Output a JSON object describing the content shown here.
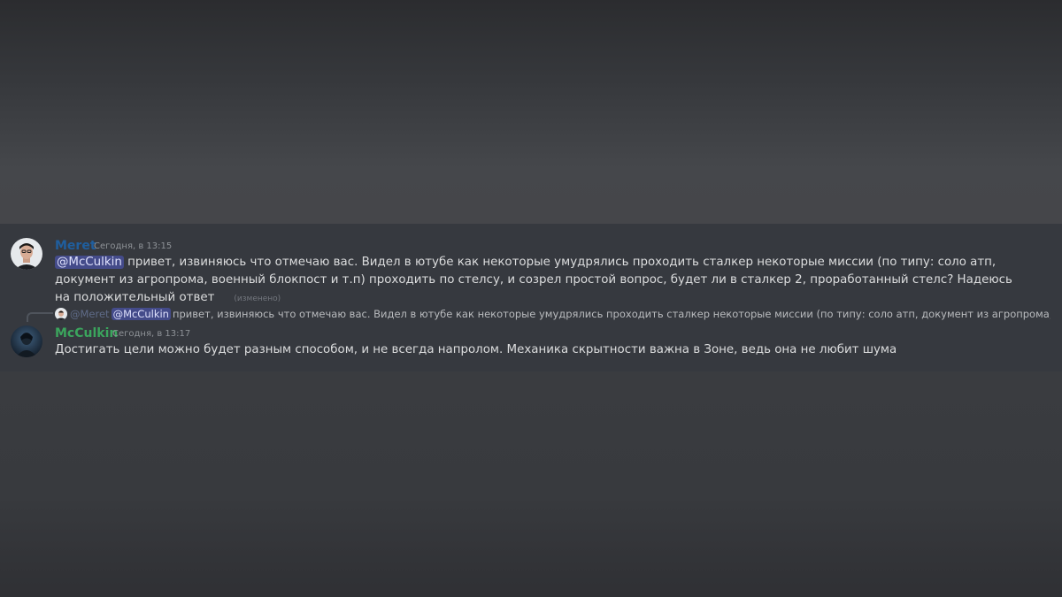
{
  "messages": [
    {
      "author": "Meret",
      "author_color": "#1f5e9e",
      "timestamp": "Сегодня, в 13:15",
      "mention": "@McCulkin",
      "text": " привет, извиняюсь что отмечаю вас. Видел в ютубе как некоторые умудрялись проходить сталкер некоторые миссии (по типу: соло атп, документ из агропрома, военный блокпост и т.п) проходить по стелсу, и созрел простой вопрос, будет ли в сталкер 2, проработанный стелс? Надеюсь на положительный ответ",
      "edited": "(изменено)"
    },
    {
      "reply": {
        "author": "@Meret",
        "mention": "@McCulkin",
        "text": "привет, извиняюсь что отмечаю вас. Видел в ютубе как некоторые умудрялись проходить сталкер некоторые миссии (по типу: соло атп, документ из агропрома, военный блок..."
      },
      "author": "McCulkin",
      "author_color": "#3ba55d",
      "timestamp": "Сегодня, в 13:17",
      "text": "Достигать цели можно будет разным способом, и не всегда напролом. Механика скрытности важна в Зоне, ведь она не любит шума"
    }
  ]
}
